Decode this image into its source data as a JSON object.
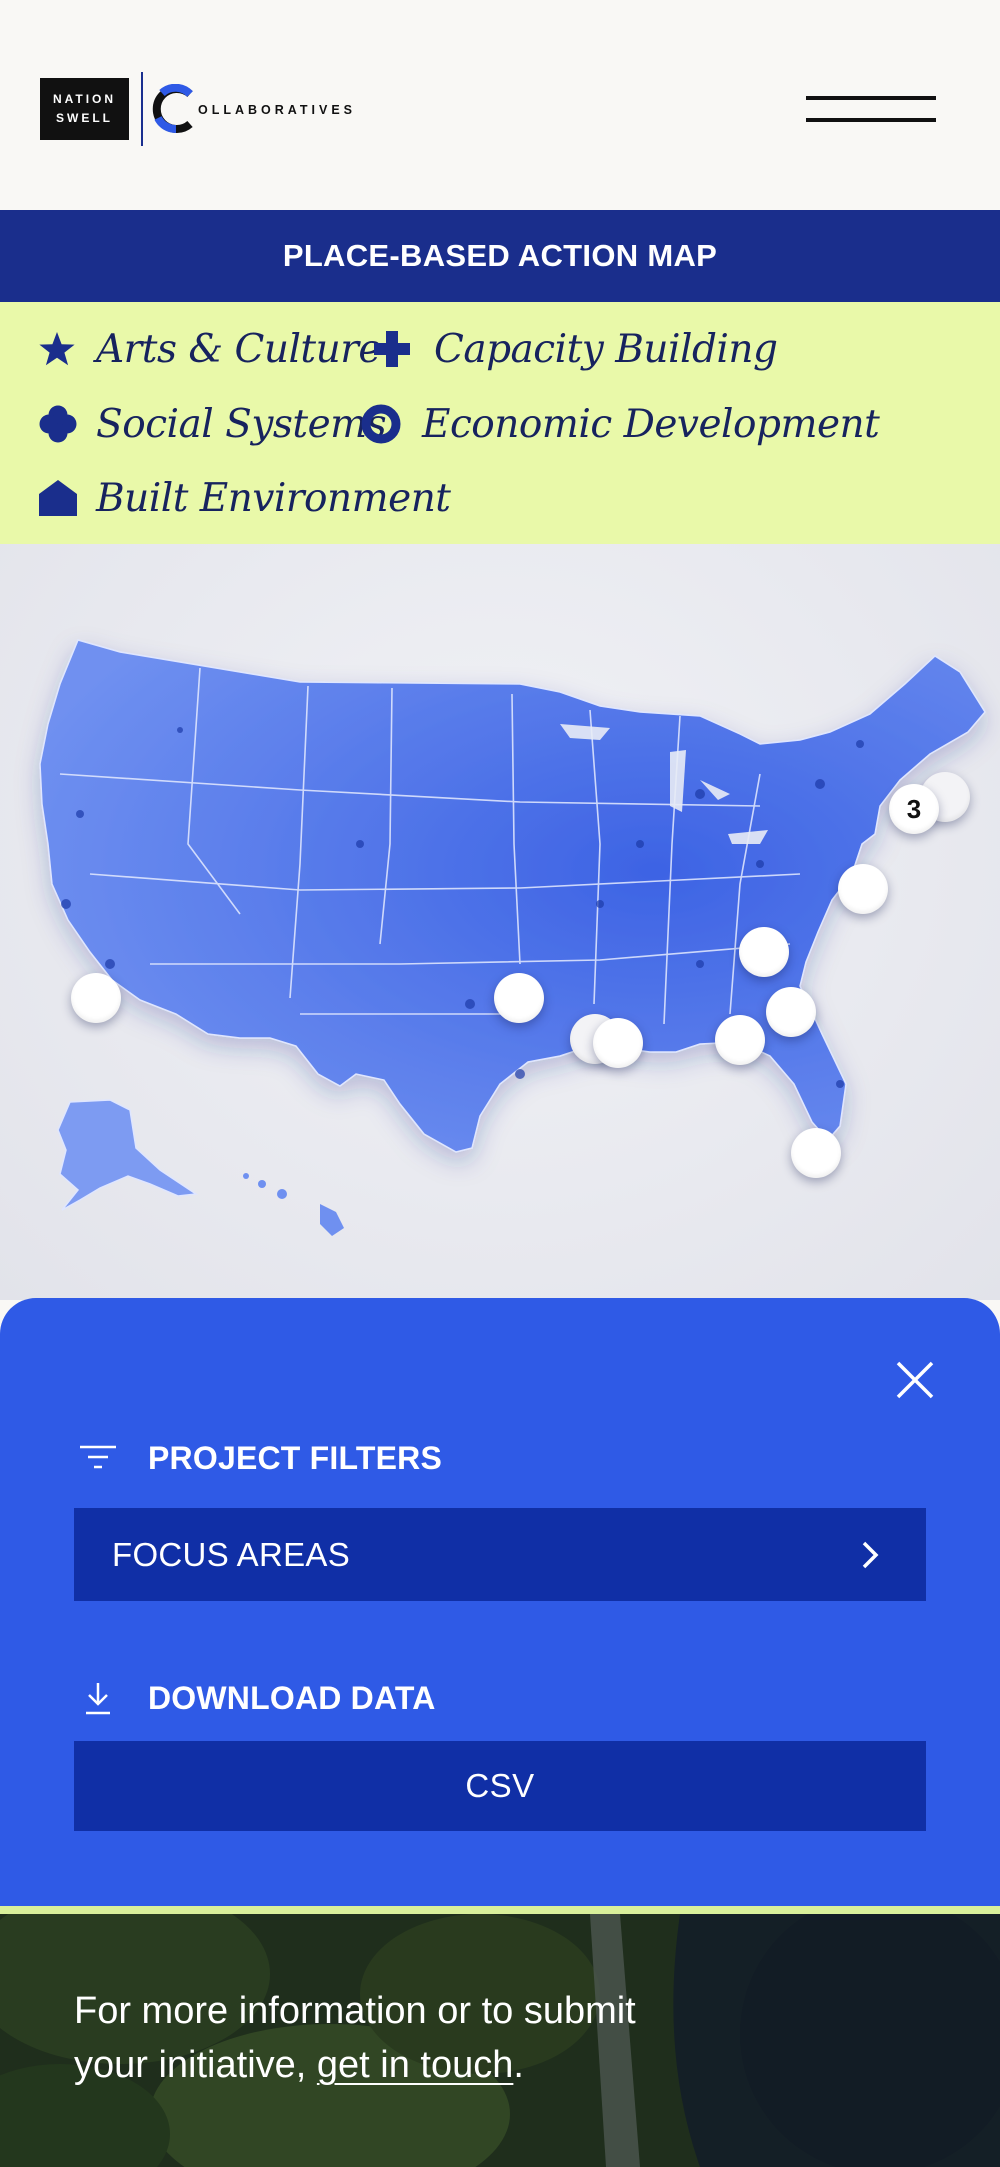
{
  "header": {
    "logo_line1": "NATION",
    "logo_line2": "SWELL",
    "collab_text": "OLLABORATIVES",
    "menu_icon": "hamburger-menu-icon"
  },
  "title_bar": {
    "title": "PLACE-BASED ACTION MAP"
  },
  "legend": {
    "items": [
      {
        "icon": "star-icon",
        "label": "Arts & Culture"
      },
      {
        "icon": "plus-icon",
        "label": "Capacity Building"
      },
      {
        "icon": "clover-icon",
        "label": "Social Systems"
      },
      {
        "icon": "ring-icon",
        "label": "Economic Development"
      },
      {
        "icon": "house-icon",
        "label": "Built Environment"
      }
    ]
  },
  "map": {
    "cluster_count": "3",
    "pins_visible": 14
  },
  "panel": {
    "filters_heading": "PROJECT FILTERS",
    "focus_areas_label": "FOCUS AREAS",
    "download_heading": "DOWNLOAD DATA",
    "csv_label": "CSV"
  },
  "footer": {
    "text_before": "For more information or to submit your initiative, ",
    "link_text": "get in touch",
    "text_after": "."
  },
  "colors": {
    "navy": "#1a2e8c",
    "lime": "#e9f9a9",
    "panel_blue": "#2f5ae6",
    "button_blue": "#102fa6",
    "map_blue": "#4f74ea"
  }
}
